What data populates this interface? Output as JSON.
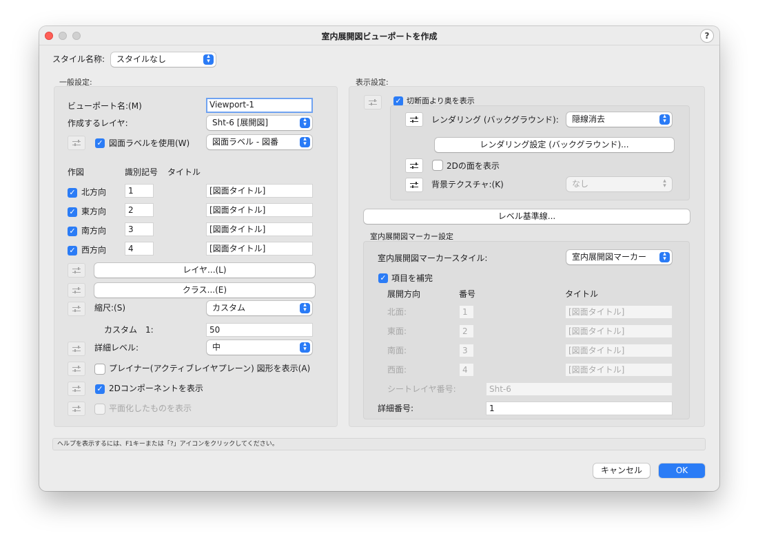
{
  "window": {
    "title": "室内展開図ビューポートを作成",
    "help": "?"
  },
  "style": {
    "label": "スタイル名称:",
    "value": "スタイルなし"
  },
  "general": {
    "section": "一般設定:",
    "viewport_name_label": "ビューポート名:(M)",
    "viewport_name_value": "Viewport-1",
    "layer_label": "作成するレイヤ:",
    "layer_value": "Sht-6 [展開図]",
    "use_label_text": "図面ラベルを使用(W)",
    "label_value": "図面ラベル - 図番",
    "col_draw": "作図",
    "col_id": "識別記号",
    "col_title": "タイトル",
    "directions": [
      {
        "name": "北方向",
        "id": "1",
        "title": "[図面タイトル]"
      },
      {
        "name": "東方向",
        "id": "2",
        "title": "[図面タイトル]"
      },
      {
        "name": "南方向",
        "id": "3",
        "title": "[図面タイトル]"
      },
      {
        "name": "西方向",
        "id": "4",
        "title": "[図面タイトル]"
      }
    ],
    "layers_btn": "レイヤ...(L)",
    "classes_btn": "クラス...(E)",
    "scale_label": "縮尺:(S)",
    "scale_value": "カスタム",
    "custom_label": "カスタム　1:",
    "custom_value": "50",
    "detail_label": "詳細レベル:",
    "detail_value": "中",
    "planar_label": "プレイナー(アクティブレイヤプレーン) 図形を表示(A)",
    "show_2d_label": "2Dコンポーネントを表示",
    "flatten_label": "平面化したものを表示"
  },
  "display": {
    "section": "表示設定:",
    "behind_cut_label": "切断面より奥を表示",
    "rendering_label": "レンダリング (バックグラウンド):",
    "rendering_value": "隠線消去",
    "rendering_settings_btn": "レンダリング設定 (バックグラウンド)...",
    "show_2d_faces_label": "2Dの面を表示",
    "bg_texture_label": "背景テクスチャ:(K)",
    "bg_texture_value": "なし",
    "level_btn": "レベル基準線..."
  },
  "marker": {
    "section": "室内展開図マーカー設定",
    "style_label": "室内展開図マーカースタイル:",
    "style_value": "室内展開図マーカー",
    "complete_label": "項目を補完",
    "col_dir": "展開方向",
    "col_num": "番号",
    "col_title": "タイトル",
    "rows": [
      {
        "name": "北面:",
        "num": "1",
        "title": "[図面タイトル]"
      },
      {
        "name": "東面:",
        "num": "2",
        "title": "[図面タイトル]"
      },
      {
        "name": "南面:",
        "num": "3",
        "title": "[図面タイトル]"
      },
      {
        "name": "西面:",
        "num": "4",
        "title": "[図面タイトル]"
      }
    ],
    "sheet_layer_label": "シートレイヤ番号:",
    "sheet_layer_value": "Sht-6",
    "detail_num_label": "詳細番号:",
    "detail_num_value": "1"
  },
  "status": "ヘルプを表示するには、F1キーまたは「?」アイコンをクリックしてください。",
  "buttons": {
    "cancel": "キャンセル",
    "ok": "OK"
  },
  "colors": {
    "accent": "#2b7cf6",
    "close": "#ff5f57"
  }
}
